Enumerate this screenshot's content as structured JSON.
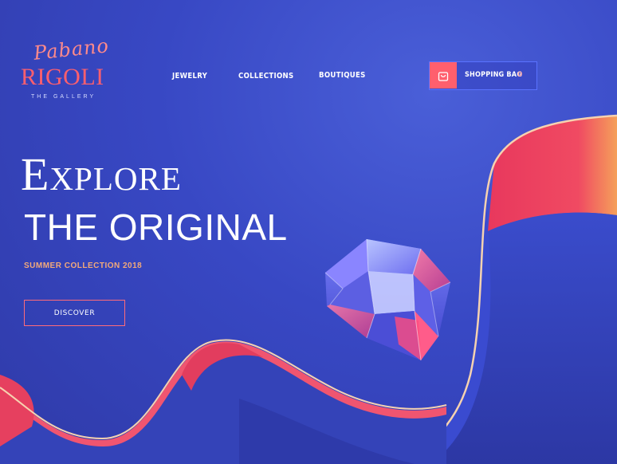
{
  "brand": {
    "script": "Pabano",
    "name": "RIGOLI",
    "tagline": "THE GALLERY"
  },
  "nav": {
    "items": [
      {
        "label": "JEWELRY"
      },
      {
        "label": "COLLECTIONS"
      },
      {
        "label": "BOUTIQUES"
      }
    ]
  },
  "cart": {
    "label": "SHOPPING BAG",
    "count": "0",
    "icon": "shopping-bag-icon"
  },
  "hero": {
    "line1": "Explore",
    "line2": "THE ORIGINAL",
    "subtitle": "SUMMER COLLECTION 2018",
    "cta": "DISCOVER"
  },
  "colors": {
    "background": "#3848c4",
    "accent": "#ff5f6d",
    "gold": "#f2a97a",
    "ribbon": "#e8435f"
  }
}
